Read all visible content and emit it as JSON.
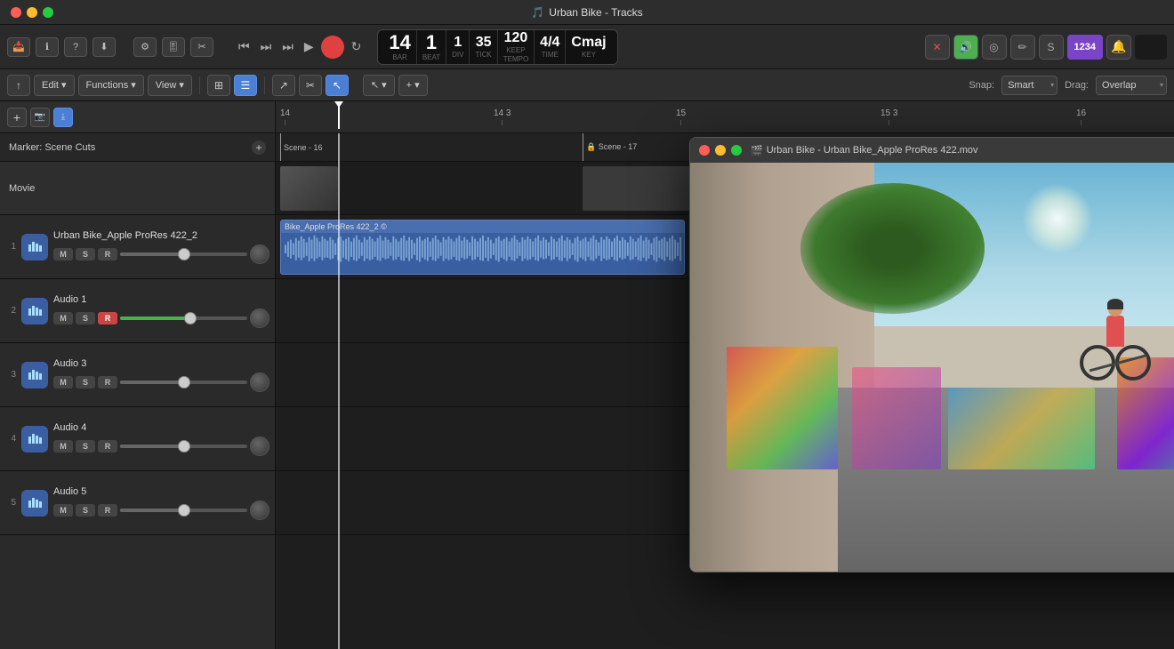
{
  "app": {
    "title": "Urban Bike - Tracks",
    "icon": "🎵"
  },
  "transport": {
    "rewind_label": "⏮",
    "fast_forward_label": "⏭",
    "skip_back_label": "⏪",
    "play_label": "▶",
    "record_label": "⏺",
    "loop_label": "↻",
    "bar": "14",
    "beat": "1",
    "div": "1",
    "tick": "35",
    "tempo": "120",
    "keep_label": "KEEP",
    "time_sig_top": "4",
    "time_sig_bot": "4",
    "key": "Cmaj",
    "bar_label": "BAR",
    "beat_label": "BEAT",
    "div_label": "DIV",
    "tick_label": "TICK",
    "tempo_label": "TEMPO",
    "time_label": "TIME",
    "key_label": "KEY"
  },
  "right_controls": {
    "close_label": "✕",
    "speaker_label": "🔊",
    "target_label": "◎",
    "pencil_label": "✏",
    "s_label": "S",
    "user_badge": "1234",
    "bell_label": "🔔"
  },
  "toolbar": {
    "edit_label": "Edit",
    "functions_label": "Functions",
    "view_label": "View",
    "snap_label": "Snap:",
    "snap_value": "Smart",
    "drag_label": "Drag:",
    "drag_value": "Overlap",
    "chevron": "▾"
  },
  "track_headers_toolbar": {
    "add_label": "+",
    "scene_icon": "📷",
    "capture_icon": "⤓"
  },
  "marker": {
    "label": "Marker: Scene Cuts",
    "plus": "+"
  },
  "movie_track": {
    "label": "Movie"
  },
  "timeline": {
    "markers": [
      {
        "position": 0,
        "label": "14"
      },
      {
        "position": 225,
        "label": "14 3"
      },
      {
        "position": 450,
        "label": "15"
      },
      {
        "position": 675,
        "label": "15 3"
      },
      {
        "position": 900,
        "label": "16"
      }
    ],
    "scenes": [
      {
        "label": "Scene - 16",
        "position": 10
      },
      {
        "label": "Scene - 17",
        "position": 346
      }
    ]
  },
  "tracks": [
    {
      "number": "1",
      "name": "Urban Bike_Apple ProRes 422_2",
      "controls": [
        "M",
        "S",
        "R"
      ],
      "fader_green": false,
      "has_clip": true
    },
    {
      "number": "2",
      "name": "Audio 1",
      "controls": [
        "M",
        "S",
        "R"
      ],
      "fader_green": true,
      "has_clip": false
    },
    {
      "number": "3",
      "name": "Audio 3",
      "controls": [
        "M",
        "S",
        "R"
      ],
      "fader_green": false,
      "has_clip": false
    },
    {
      "number": "4",
      "name": "Audio 4",
      "controls": [
        "M",
        "S",
        "R"
      ],
      "fader_green": false,
      "has_clip": false
    },
    {
      "number": "5",
      "name": "Audio 5",
      "controls": [
        "M",
        "S",
        "R"
      ],
      "fader_green": false,
      "has_clip": false
    }
  ],
  "video_window": {
    "title": "Urban Bike - Urban Bike_Apple ProRes 422.mov",
    "icon": "🎬"
  },
  "clip": {
    "label": "Bike_Apple ProRes 422_2 ©"
  }
}
